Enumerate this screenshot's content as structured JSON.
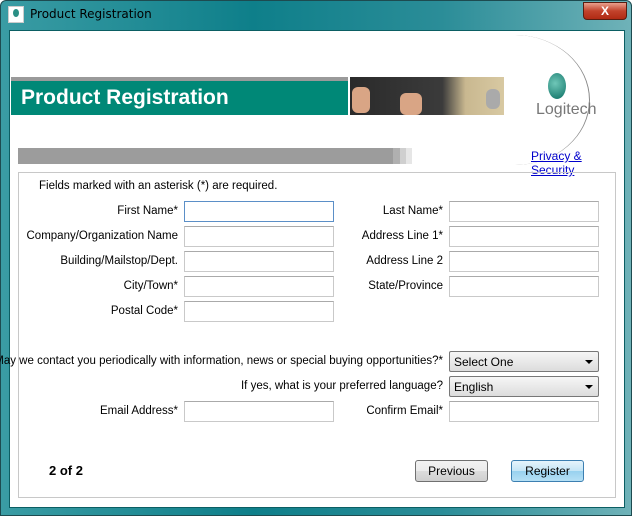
{
  "window": {
    "title": "Product Registration",
    "close_label": "X",
    "logo_small": "Logitech"
  },
  "banner": {
    "title": "Product Registration",
    "brand": "Logitech",
    "privacy_link": "Privacy & Security"
  },
  "progress": {
    "step": 2,
    "total": 2
  },
  "form": {
    "required_note": "Fields marked with an asterisk (*) are required.",
    "left": [
      {
        "label": "First Name*",
        "value": ""
      },
      {
        "label": "Company/Organization Name",
        "value": ""
      },
      {
        "label": "Building/Mailstop/Dept.",
        "value": ""
      },
      {
        "label": "City/Town*",
        "value": ""
      },
      {
        "label": "Postal Code*",
        "value": ""
      }
    ],
    "right": [
      {
        "label": "Last Name*",
        "value": ""
      },
      {
        "label": "Address Line 1*",
        "value": ""
      },
      {
        "label": "Address Line 2",
        "value": ""
      },
      {
        "label": "State/Province",
        "value": ""
      }
    ],
    "contact_question": "May we contact you periodically with information, news or special buying opportunities?*",
    "contact_selected": "Select One",
    "language_question": "If yes, what is your preferred language?",
    "language_selected": "English",
    "email_label": "Email Address*",
    "confirm_email_label": "Confirm Email*"
  },
  "footer": {
    "page_indicator": "2 of 2",
    "previous_label": "Previous",
    "register_label": "Register"
  },
  "colors": {
    "accent": "#008877",
    "link": "#0000cc"
  }
}
